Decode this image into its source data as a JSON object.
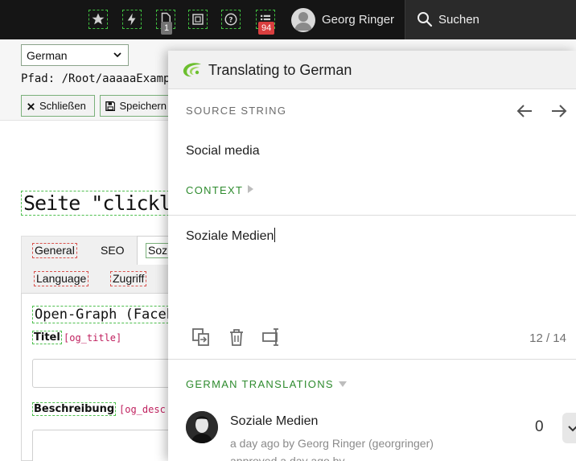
{
  "topbar": {
    "icons": [
      "star-icon",
      "flash-icon",
      "document-icon",
      "frame-icon",
      "help-icon",
      "list-icon"
    ],
    "document_badge": "1",
    "list_badge": "94",
    "user_name": "Georg Ringer",
    "search_label": "Suchen"
  },
  "cms": {
    "language_select": "German",
    "path": "Pfad: /Root/aaaaaExamples",
    "close_label": "Schließen",
    "save_label": "Speichern",
    "page_title": "Seite \"clicklarge",
    "tabs": [
      "General",
      "SEO",
      "Soz",
      "Language",
      "Zugriff"
    ],
    "og_heading": "Open-Graph (Facebo",
    "title_label": "Titel",
    "title_code": "[og_title]",
    "description_label": "Beschreibung",
    "description_code": "[og_desc"
  },
  "panel": {
    "title": "Translating to German",
    "source_label": "SOURCE STRING",
    "source_text": "Social media",
    "context_label": "CONTEXT",
    "translation_value": "Soziale Medien",
    "char_count": "12 / 14",
    "translations_label": "GERMAN TRANSLATIONS",
    "translation": {
      "text": "Soziale Medien",
      "meta": "a day ago by Georg Ringer (georgringer)",
      "approved": "approved a day ago by",
      "votes": "0"
    }
  },
  "colors": {
    "topbar_bg": "#151515",
    "accent_green": "#2e8b2e",
    "badge_red": "#d93f3f"
  }
}
